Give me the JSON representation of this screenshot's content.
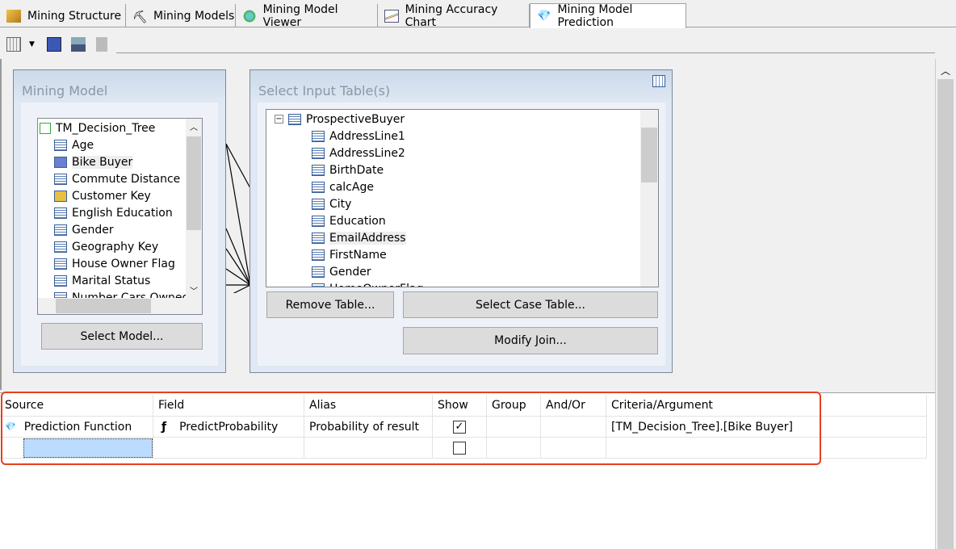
{
  "tabs": [
    {
      "label": "Mining Structure",
      "icon": "mining-structure-icon"
    },
    {
      "label": "Mining Models",
      "icon": "pickaxe-icon"
    },
    {
      "label": "Mining Model Viewer",
      "icon": "viewer-icon"
    },
    {
      "label": "Mining Accuracy Chart",
      "icon": "chart-icon"
    },
    {
      "label": "Mining Model Prediction",
      "icon": "diamond-icon",
      "active": true
    }
  ],
  "mining_model": {
    "title": "Mining Model",
    "root": "TM_Decision_Tree",
    "columns": [
      "Age",
      "Bike Buyer",
      "Commute Distance",
      "Customer Key",
      "English Education",
      "Gender",
      "Geography Key",
      "House Owner Flag",
      "Marital Status",
      "Number Cars Owned"
    ],
    "select_button": "Select Model..."
  },
  "input_table": {
    "title": "Select Input Table(s)",
    "table": "ProspectiveBuyer",
    "columns": [
      "AddressLine1",
      "AddressLine2",
      "BirthDate",
      "calcAge",
      "City",
      "Education",
      "EmailAddress",
      "FirstName",
      "Gender",
      "HomeOwnerFlag"
    ],
    "remove_button": "Remove Table...",
    "case_button": "Select Case Table...",
    "join_button": "Modify Join..."
  },
  "grid": {
    "headers": [
      "Source",
      "Field",
      "Alias",
      "Show",
      "Group",
      "And/Or",
      "Criteria/Argument"
    ],
    "rows": [
      {
        "source": "Prediction Function",
        "field": "PredictProbability",
        "alias": "Probability of result",
        "show": true,
        "group": "",
        "andor": "",
        "criteria": "[TM_Decision_Tree].[Bike Buyer]"
      },
      {
        "source": "",
        "field": "",
        "alias": "",
        "show": false,
        "group": "",
        "andor": "",
        "criteria": ""
      }
    ]
  },
  "colors": {
    "highlight": "#e8401c",
    "selected_cell": "#bcdcff"
  }
}
